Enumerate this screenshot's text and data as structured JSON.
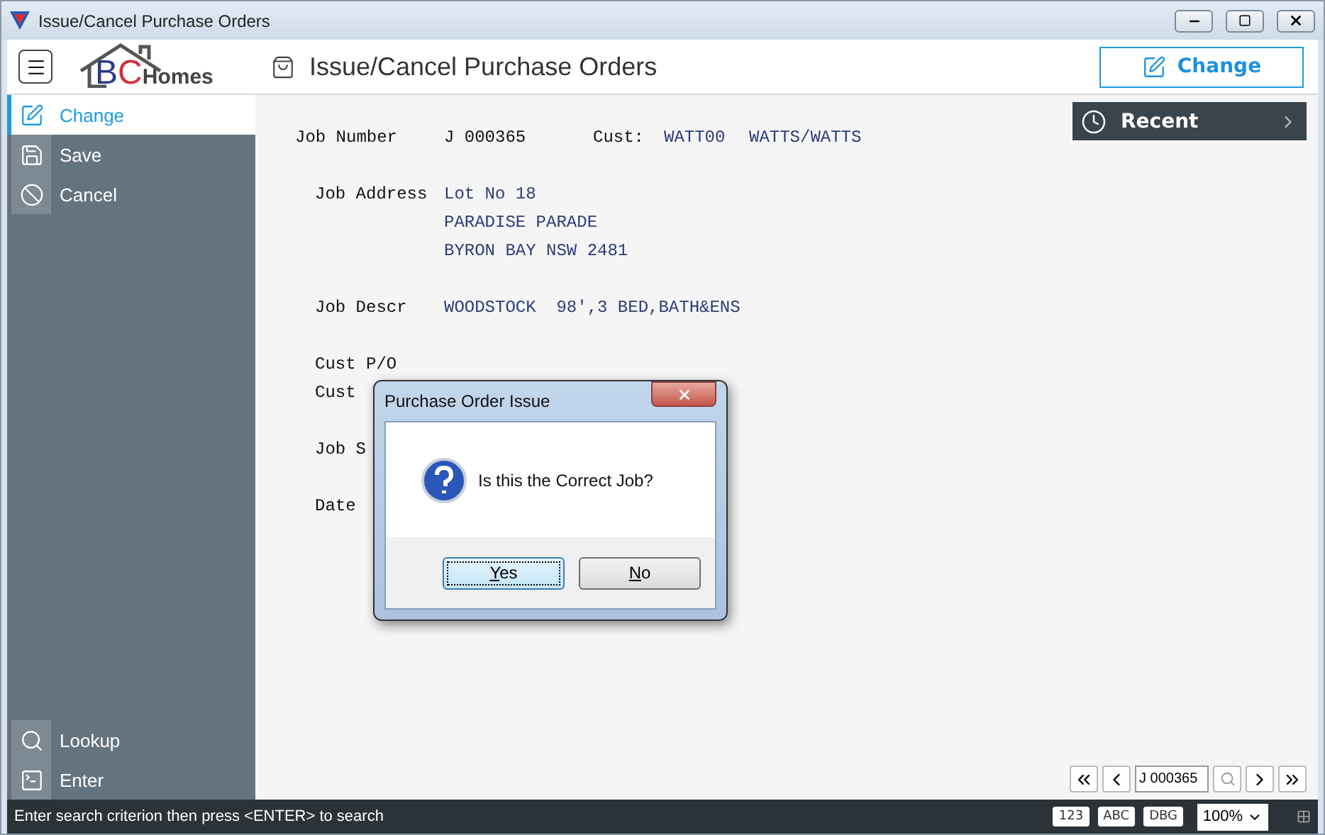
{
  "window": {
    "title": "Issue/Cancel Purchase Orders"
  },
  "logo": {
    "letters": "BC",
    "word": "Homes"
  },
  "header": {
    "title": "Issue/Cancel Purchase Orders",
    "action_button": "Change"
  },
  "sidebar": {
    "items": [
      {
        "label": "Change",
        "kind": "edit",
        "selected": true
      },
      {
        "label": "Save",
        "kind": "save",
        "selected": false
      },
      {
        "label": "Cancel",
        "kind": "cancel",
        "selected": false
      }
    ],
    "bottom_items": [
      {
        "label": "Lookup",
        "kind": "search"
      },
      {
        "label": "Enter",
        "kind": "terminal"
      }
    ]
  },
  "recent": {
    "label": "Recent"
  },
  "job": {
    "number_label": "Job Number",
    "number": "J 000365",
    "cust_label": "Cust:",
    "cust_code": "WATT00",
    "cust_name": "WATTS/WATTS",
    "groups": [
      [
        {
          "label": "Job Address",
          "lines": [
            "Lot No 18",
            "PARADISE PARADE",
            "BYRON BAY NSW 2481"
          ]
        }
      ],
      [
        {
          "label": "Job Descr",
          "lines": [
            "WOODSTOCK  98',3 BED,BATH&ENS"
          ]
        }
      ],
      [
        {
          "label": "Cust P/O"
        },
        {
          "label": "Cust"
        }
      ],
      [
        {
          "label": "Job S"
        }
      ],
      [
        {
          "label": "Date"
        }
      ]
    ]
  },
  "navigator": {
    "value": "J 000365"
  },
  "dialog": {
    "title": "Purchase Order Issue",
    "message": "Is this the Correct Job?",
    "buttons": [
      {
        "label": "Yes",
        "default": true
      },
      {
        "label": "No",
        "default": false
      }
    ]
  },
  "status_bar": {
    "message": "Enter search criterion then press <ENTER> to search",
    "badges": [
      "123",
      "ABC",
      "DBG"
    ],
    "zoom": "100%"
  }
}
